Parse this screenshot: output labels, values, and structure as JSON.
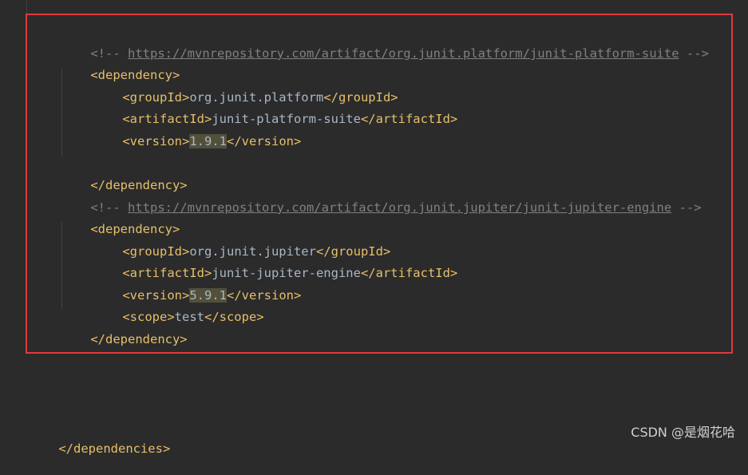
{
  "comment1": {
    "open": "<!--",
    "url": "https://mvnrepository.com/artifact/org.junit.platform/junit-platform-suite",
    "close": "-->"
  },
  "dep1": {
    "open_tag": "<dependency>",
    "close_tag": "</dependency>",
    "group_open": "<groupId>",
    "group_value": "org.junit.platform",
    "group_close": "</groupId>",
    "artifact_open": "<artifactId>",
    "artifact_value": "junit-platform-suite",
    "artifact_close": "</artifactId>",
    "version_open": "<version>",
    "version_value": "1.9.1",
    "version_close": "</version>"
  },
  "comment2": {
    "open": "<!--",
    "url": "https://mvnrepository.com/artifact/org.junit.jupiter/junit-jupiter-engine",
    "close": "-->"
  },
  "dep2": {
    "open_tag": "<dependency>",
    "close_tag": "</dependency>",
    "group_open": "<groupId>",
    "group_value": "org.junit.jupiter",
    "group_close": "</groupId>",
    "artifact_open": "<artifactId>",
    "artifact_value": "junit-jupiter-engine",
    "artifact_close": "</artifactId>",
    "version_open": "<version>",
    "version_value": "5.9.1",
    "version_close": "</version>",
    "scope_open": "<scope>",
    "scope_value": "test",
    "scope_close": "</scope>"
  },
  "dependencies_close": "</dependencies>",
  "watermark": "CSDN @是烟花哈",
  "colors": {
    "background": "#2b2b2b",
    "tag": "#e8bf6a",
    "text": "#a9b7c6",
    "comment": "#808080",
    "highlight_border": "#e0393a",
    "version_highlight": "#52503a"
  }
}
